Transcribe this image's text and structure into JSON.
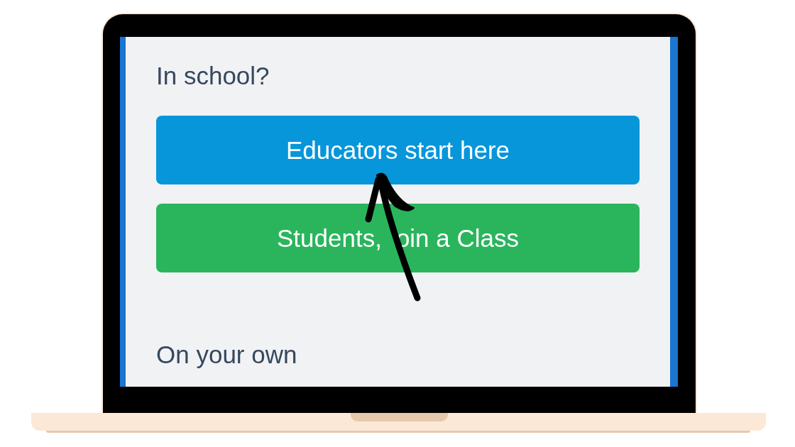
{
  "screen": {
    "sections": [
      {
        "heading": "In school?",
        "buttons": [
          {
            "label_parts": [
              "Educators start here"
            ],
            "kind": "primary"
          },
          {
            "label_parts": [
              "Students,",
              "oin a Class"
            ],
            "kind": "success"
          }
        ]
      },
      {
        "heading": "On your own"
      }
    ]
  }
}
